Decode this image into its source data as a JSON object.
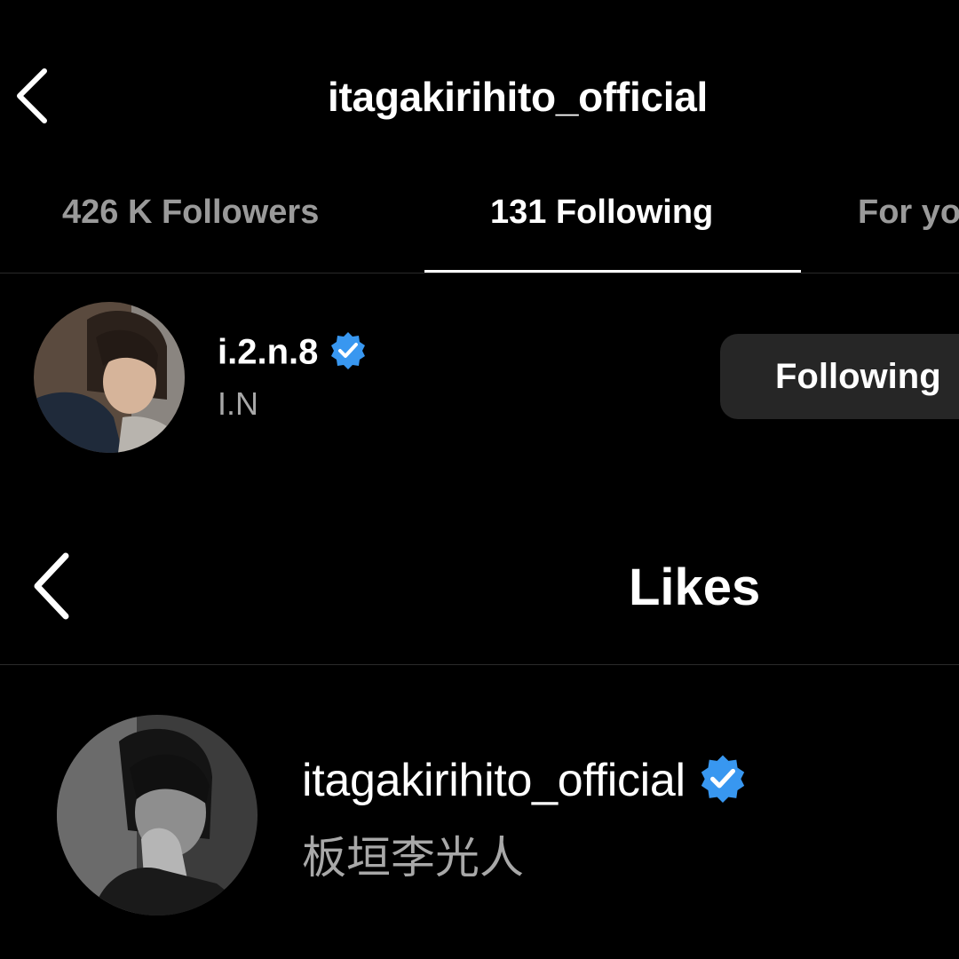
{
  "top_header": {
    "title": "itagakirihito_official"
  },
  "tabs": [
    {
      "label": "426 K Followers"
    },
    {
      "label": "131 Following"
    },
    {
      "label": "For yo"
    }
  ],
  "following_row": {
    "username": "i.2.n.8",
    "full_name": "I.N",
    "button_label": "Following",
    "verified": true
  },
  "likes_header": {
    "title": "Likes"
  },
  "likes_row": {
    "username": "itagakirihito_official",
    "full_name": "板垣李光人",
    "verified": true
  },
  "colors": {
    "background": "#000000",
    "button": "#262626",
    "verified": "#3897f0",
    "muted": "#a8a8a8"
  }
}
